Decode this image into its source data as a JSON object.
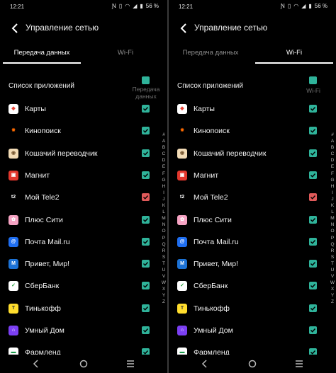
{
  "colors": {
    "check_green": "#2fb39a",
    "check_red": "#e05a5a",
    "background": "#000000"
  },
  "status_bar": {
    "time": "12:21",
    "battery": "56 %"
  },
  "header": {
    "title": "Управление сетью"
  },
  "tabs": {
    "data": "Передача данных",
    "wifi": "Wi-Fi"
  },
  "list": {
    "title": "Список приложений",
    "col_data": "Передача данных",
    "col_wifi": "Wi-Fi"
  },
  "apps": [
    {
      "name": "Карты",
      "icon": "maps-icon",
      "left_red": false,
      "right_red": false
    },
    {
      "name": "Кинопоиск",
      "icon": "kinopoisk-icon",
      "left_red": false,
      "right_red": false
    },
    {
      "name": "Кошачий переводчик",
      "icon": "cat-translator-icon",
      "left_red": false,
      "right_red": false
    },
    {
      "name": "Магнит",
      "icon": "magnit-icon",
      "left_red": false,
      "right_red": false
    },
    {
      "name": "Мой Tele2",
      "icon": "tele2-icon",
      "left_red": true,
      "right_red": true
    },
    {
      "name": "Плюс Сити",
      "icon": "plus-city-icon",
      "left_red": false,
      "right_red": false
    },
    {
      "name": "Почта Mail.ru",
      "icon": "mail-ru-icon",
      "left_red": false,
      "right_red": false
    },
    {
      "name": "Привет, Мир!",
      "icon": "mir-icon",
      "left_red": false,
      "right_red": false
    },
    {
      "name": "СберБанк",
      "icon": "sberbank-icon",
      "left_red": false,
      "right_red": false
    },
    {
      "name": "Тинькофф",
      "icon": "tinkoff-icon",
      "left_red": false,
      "right_red": false
    },
    {
      "name": "Умный Дом",
      "icon": "smart-home-icon",
      "left_red": false,
      "right_red": false
    },
    {
      "name": "Фармленд",
      "icon": "farmlend-icon",
      "left_red": false,
      "right_red": false
    }
  ],
  "alphabet": [
    "#",
    "A",
    "B",
    "C",
    "D",
    "E",
    "F",
    "G",
    "H",
    "I",
    "J",
    "K",
    "L",
    "M",
    "N",
    "O",
    "P",
    "Q",
    "R",
    "S",
    "T",
    "U",
    "V",
    "W",
    "X",
    "Y",
    "Z"
  ]
}
